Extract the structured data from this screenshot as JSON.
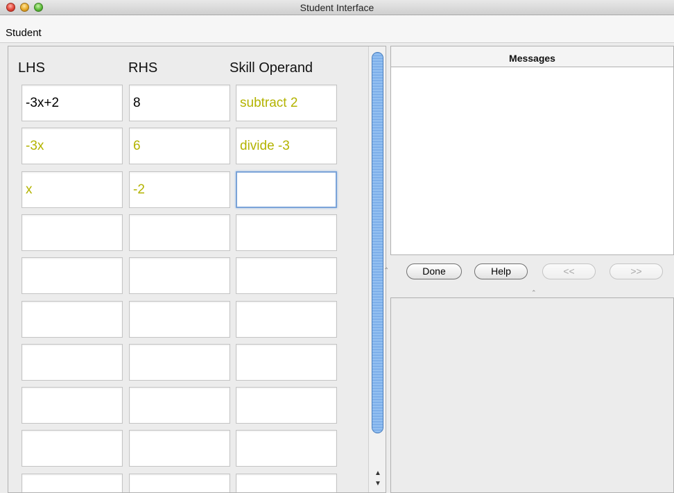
{
  "window": {
    "title": "Student Interface"
  },
  "menu": {
    "items": [
      "Student"
    ]
  },
  "table": {
    "headers": [
      "LHS",
      "RHS",
      "Skill Operand"
    ],
    "rows": [
      [
        "-3x+2",
        "8",
        "subtract 2"
      ],
      [
        "-3x",
        "6",
        "divide -3"
      ],
      [
        "x",
        "-2",
        ""
      ],
      [
        "",
        "",
        ""
      ],
      [
        "",
        "",
        ""
      ],
      [
        "",
        "",
        ""
      ],
      [
        "",
        "",
        ""
      ],
      [
        "",
        "",
        ""
      ],
      [
        "",
        "",
        ""
      ],
      [
        "",
        "",
        ""
      ]
    ],
    "answer_color": "#b3b300",
    "given_color": "#000000"
  },
  "messages": {
    "title": "Messages"
  },
  "buttons": {
    "done": "Done",
    "help": "Help",
    "prev": "<<",
    "next": ">>"
  }
}
